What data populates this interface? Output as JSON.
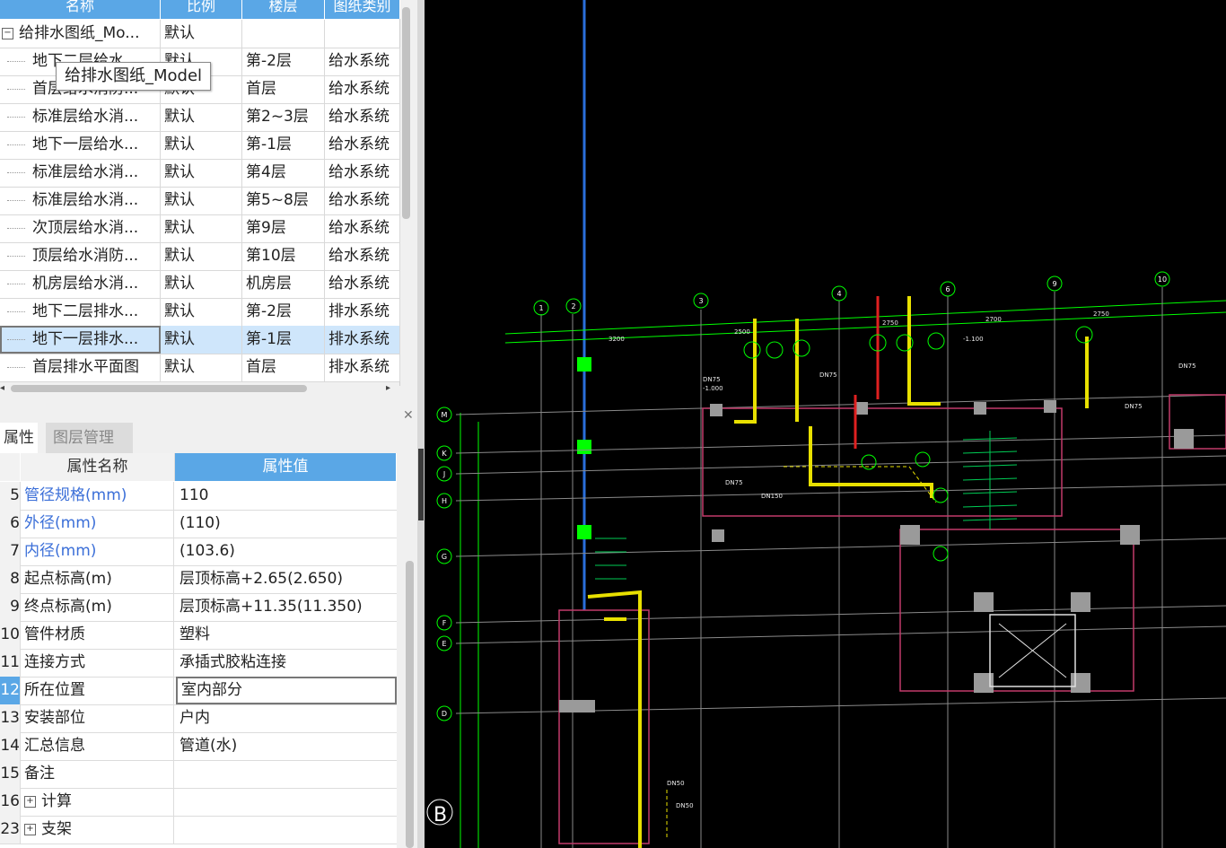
{
  "drawings": {
    "columns": [
      "名称",
      "比例",
      "楼层",
      "图纸类别"
    ],
    "root": {
      "name": "给排水图纸_Mo...",
      "scale": "默认"
    },
    "rows": [
      {
        "name": "地下二层给水...",
        "scale": "默认",
        "floor": "第-2层",
        "category": "给水系统"
      },
      {
        "name": "首层给水消防...",
        "scale": "默认",
        "floor": "首层",
        "category": "给水系统"
      },
      {
        "name": "标准层给水消...",
        "scale": "默认",
        "floor": "第2~3层",
        "category": "给水系统"
      },
      {
        "name": "地下一层给水...",
        "scale": "默认",
        "floor": "第-1层",
        "category": "给水系统"
      },
      {
        "name": "标准层给水消...",
        "scale": "默认",
        "floor": "第4层",
        "category": "给水系统"
      },
      {
        "name": "标准层给水消...",
        "scale": "默认",
        "floor": "第5~8层",
        "category": "给水系统"
      },
      {
        "name": "次顶层给水消...",
        "scale": "默认",
        "floor": "第9层",
        "category": "给水系统"
      },
      {
        "name": "顶层给水消防...",
        "scale": "默认",
        "floor": "第10层",
        "category": "给水系统"
      },
      {
        "name": "机房层给水消...",
        "scale": "默认",
        "floor": "机房层",
        "category": "给水系统"
      },
      {
        "name": "地下二层排水...",
        "scale": "默认",
        "floor": "第-2层",
        "category": "排水系统"
      },
      {
        "name": "地下一层排水...",
        "scale": "默认",
        "floor": "第-1层",
        "category": "排水系统"
      },
      {
        "name": "首层排水平面图",
        "scale": "默认",
        "floor": "首层",
        "category": "排水系统"
      }
    ],
    "tooltip": "给排水图纸_Model"
  },
  "tabs": {
    "properties": "属性",
    "layers": "图层管理"
  },
  "props": {
    "header_name": "属性名称",
    "header_value": "属性值",
    "rows": [
      {
        "num": "5",
        "name": "管径规格(mm)",
        "value": "110"
      },
      {
        "num": "6",
        "name": "外径(mm)",
        "value": "(110)"
      },
      {
        "num": "7",
        "name": "内径(mm)",
        "value": "(103.6)"
      },
      {
        "num": "8",
        "name": "起点标高(m)",
        "value": "层顶标高+2.65(2.650)"
      },
      {
        "num": "9",
        "name": "终点标高(m)",
        "value": "层顶标高+11.35(11.350)"
      },
      {
        "num": "10",
        "name": "管件材质",
        "value": "塑料"
      },
      {
        "num": "11",
        "name": "连接方式",
        "value": "承插式胶粘连接"
      },
      {
        "num": "12",
        "name": "所在位置",
        "value": "室内部分"
      },
      {
        "num": "13",
        "name": "安装部位",
        "value": "户内"
      },
      {
        "num": "14",
        "name": "汇总信息",
        "value": "管道(水)"
      },
      {
        "num": "15",
        "name": "备注",
        "value": ""
      },
      {
        "num": "16",
        "name": "计算",
        "value": ""
      },
      {
        "num": "23",
        "name": "支架",
        "value": ""
      }
    ]
  },
  "cad": {
    "grid_top": [
      "1",
      "2",
      "3",
      "4",
      "6",
      "9",
      "10"
    ],
    "grid_left": [
      "M",
      "K",
      "J",
      "H",
      "G",
      "F",
      "E",
      "D"
    ],
    "dimensions": [
      "3200",
      "2750",
      "2700",
      "2750",
      "2500"
    ],
    "corner_label": "B"
  }
}
